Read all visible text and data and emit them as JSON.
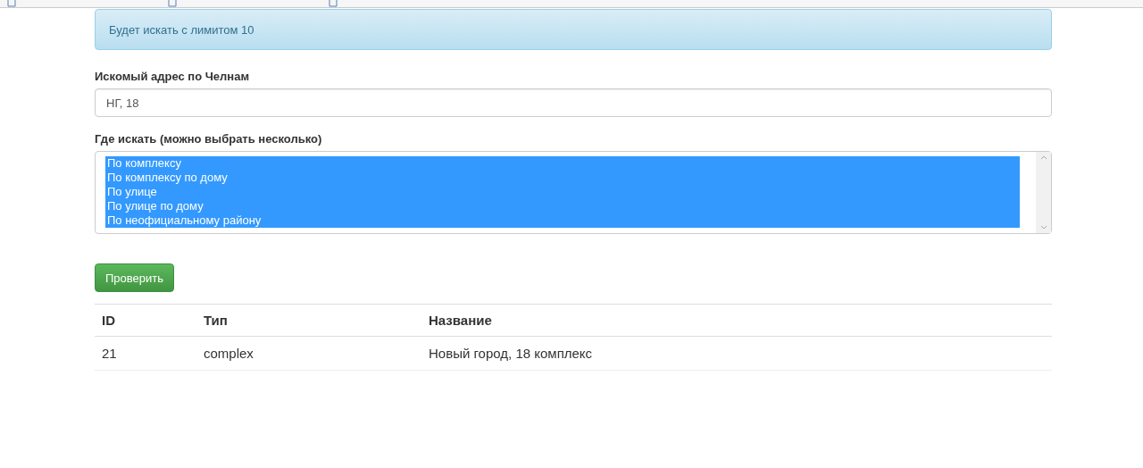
{
  "alert": {
    "text": "Будет искать с лимитом 10"
  },
  "address_field": {
    "label": "Искомый адрес по Челнам",
    "value": "НГ, 18"
  },
  "search_scope": {
    "label": "Где искать (можно выбрать несколько)",
    "options": [
      {
        "label": "По комплексу",
        "selected": true
      },
      {
        "label": "По комплексу по дому",
        "selected": true
      },
      {
        "label": "По улице",
        "selected": true
      },
      {
        "label": "По улице по дому",
        "selected": true
      },
      {
        "label": "По неофициальному району",
        "selected": true
      }
    ]
  },
  "submit_button": "Проверить",
  "table": {
    "columns": [
      "ID",
      "Тип",
      "Название"
    ],
    "rows": [
      [
        "21",
        "complex",
        "Новый город, 18 комплекс"
      ]
    ]
  }
}
